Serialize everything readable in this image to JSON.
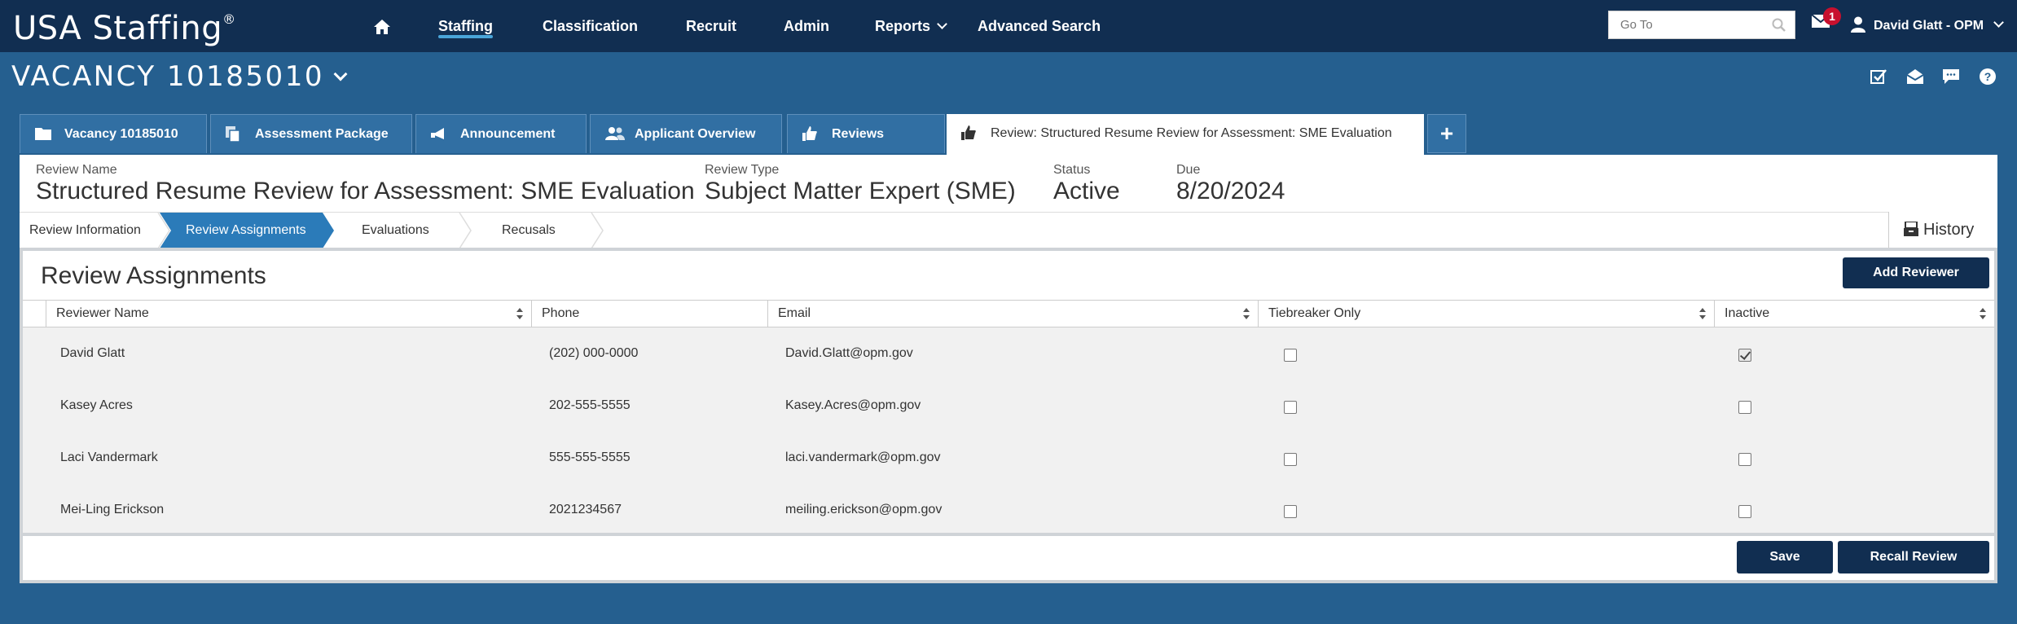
{
  "topbar": {
    "logo": "USA Staffing",
    "logo_mark": "®",
    "nav": [
      {
        "label": "Staffing"
      },
      {
        "label": "Classification"
      },
      {
        "label": "Recruit"
      },
      {
        "label": "Admin"
      },
      {
        "label": "Reports"
      },
      {
        "label": "Advanced Search"
      }
    ],
    "goto_placeholder": "Go To",
    "mail_count": "1",
    "user_name": "David Glatt - OPM"
  },
  "vacancy": {
    "title": "VACANCY 10185010"
  },
  "tabs": [
    {
      "label": "Vacancy 10185010",
      "icon": "folder-icon"
    },
    {
      "label": "Assessment Package",
      "icon": "copy-icon"
    },
    {
      "label": "Announcement",
      "icon": "megaphone-icon"
    },
    {
      "label": "Applicant Overview",
      "icon": "users-icon"
    },
    {
      "label": "Reviews",
      "icon": "thumbs-up-icon"
    },
    {
      "label": "Review: Structured Resume Review for Assessment: SME Evaluation",
      "icon": "thumbs-up-icon"
    }
  ],
  "header": {
    "review_name_label": "Review Name",
    "review_name": "Structured Resume Review for Assessment: SME Evaluation",
    "review_type_label": "Review Type",
    "review_type": "Subject Matter Expert (SME)",
    "status_label": "Status",
    "status": "Active",
    "due_label": "Due",
    "due": "8/20/2024"
  },
  "steps": [
    {
      "label": "Review Information"
    },
    {
      "label": "Review Assignments"
    },
    {
      "label": "Evaluations"
    },
    {
      "label": "Recusals"
    }
  ],
  "history_label": "History",
  "main": {
    "title": "Review Assignments",
    "add_button": "Add Reviewer",
    "columns": [
      "Reviewer Name",
      "Phone",
      "Email",
      "Tiebreaker Only",
      "Inactive"
    ],
    "rows": [
      {
        "name": "David Glatt",
        "phone": "(202) 000-0000",
        "email": "David.Glatt@opm.gov",
        "tiebreaker": false,
        "inactive": true
      },
      {
        "name": "Kasey Acres",
        "phone": "202-555-5555",
        "email": "Kasey.Acres@opm.gov",
        "tiebreaker": false,
        "inactive": false
      },
      {
        "name": "Laci Vandermark",
        "phone": "555-555-5555",
        "email": "laci.vandermark@opm.gov",
        "tiebreaker": false,
        "inactive": false
      },
      {
        "name": "Mei-Ling Erickson",
        "phone": "2021234567",
        "email": "meiling.erickson@opm.gov",
        "tiebreaker": false,
        "inactive": false
      }
    ],
    "save_button": "Save",
    "recall_button": "Recall Review"
  },
  "colors": {
    "navy": "#112e51",
    "background": "#255f8f",
    "tab": "#316fa3",
    "step_active": "#2b7bb9",
    "badge": "#c8102e"
  }
}
